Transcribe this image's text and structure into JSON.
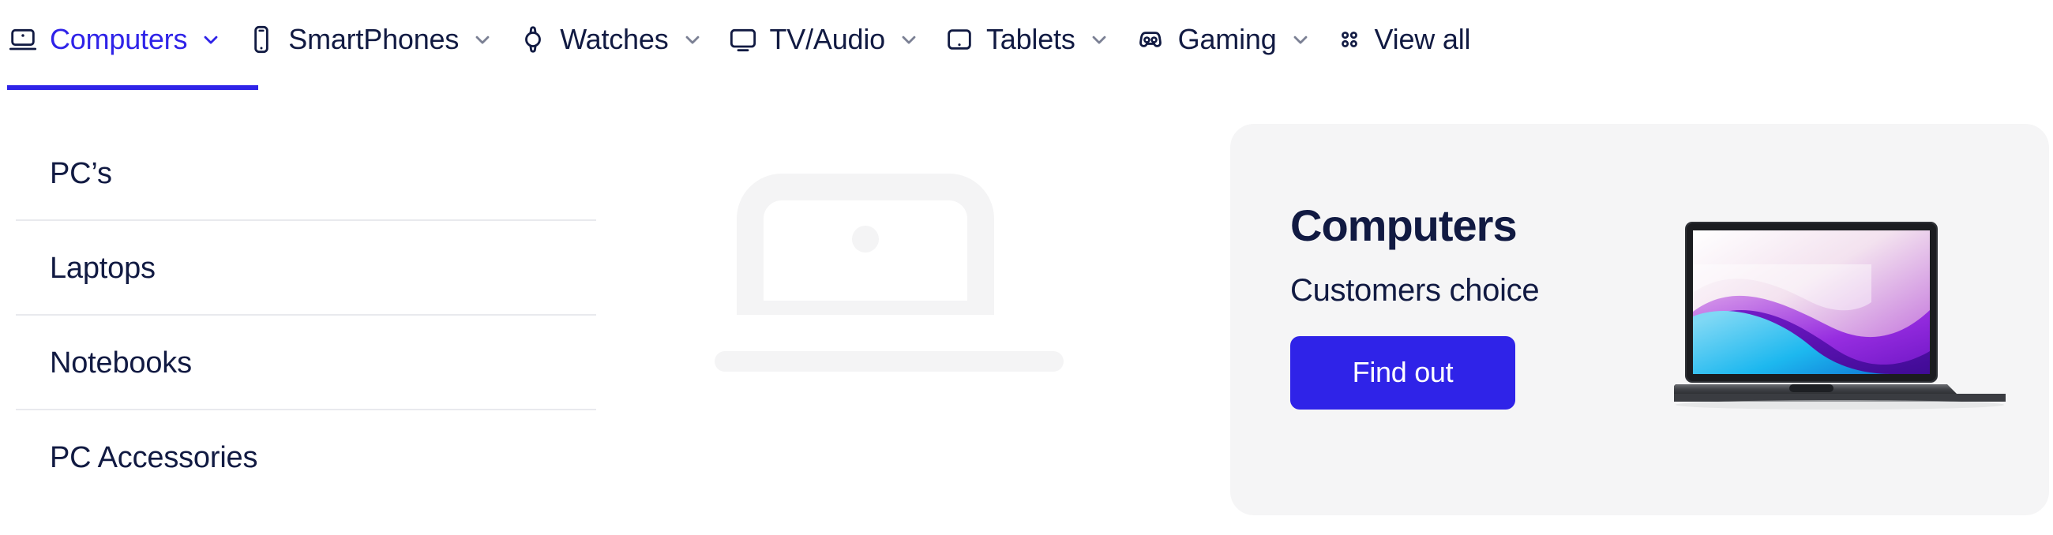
{
  "nav": {
    "tabs": [
      {
        "label": "Computers",
        "icon": "laptop-icon",
        "has_chevron": true,
        "active": true
      },
      {
        "label": "SmartPhones",
        "icon": "phone-icon",
        "has_chevron": true,
        "active": false
      },
      {
        "label": "Watches",
        "icon": "watch-icon",
        "has_chevron": true,
        "active": false
      },
      {
        "label": "TV/Audio",
        "icon": "tv-icon",
        "has_chevron": true,
        "active": false
      },
      {
        "label": "Tablets",
        "icon": "tablet-icon",
        "has_chevron": true,
        "active": false
      },
      {
        "label": "Gaming",
        "icon": "gamepad-icon",
        "has_chevron": true,
        "active": false
      },
      {
        "label": "View all",
        "icon": "grid-dots-icon",
        "has_chevron": false,
        "active": false
      }
    ]
  },
  "submenu": {
    "items": [
      {
        "label": "PC’s"
      },
      {
        "label": "Laptops"
      },
      {
        "label": "Notebooks"
      },
      {
        "label": "PC Accessories"
      }
    ]
  },
  "preview": {
    "icon": "laptop-placeholder-icon"
  },
  "promo": {
    "title": "Computers",
    "subtitle": "Customers choice",
    "button_label": "Find out",
    "image": "macbook-laptop-image"
  },
  "colors": {
    "accent": "#2f23e8",
    "text_dark": "#111a42",
    "card_bg": "#f5f5f6",
    "separator": "#e9eaee",
    "placeholder": "#f5f5f6"
  }
}
